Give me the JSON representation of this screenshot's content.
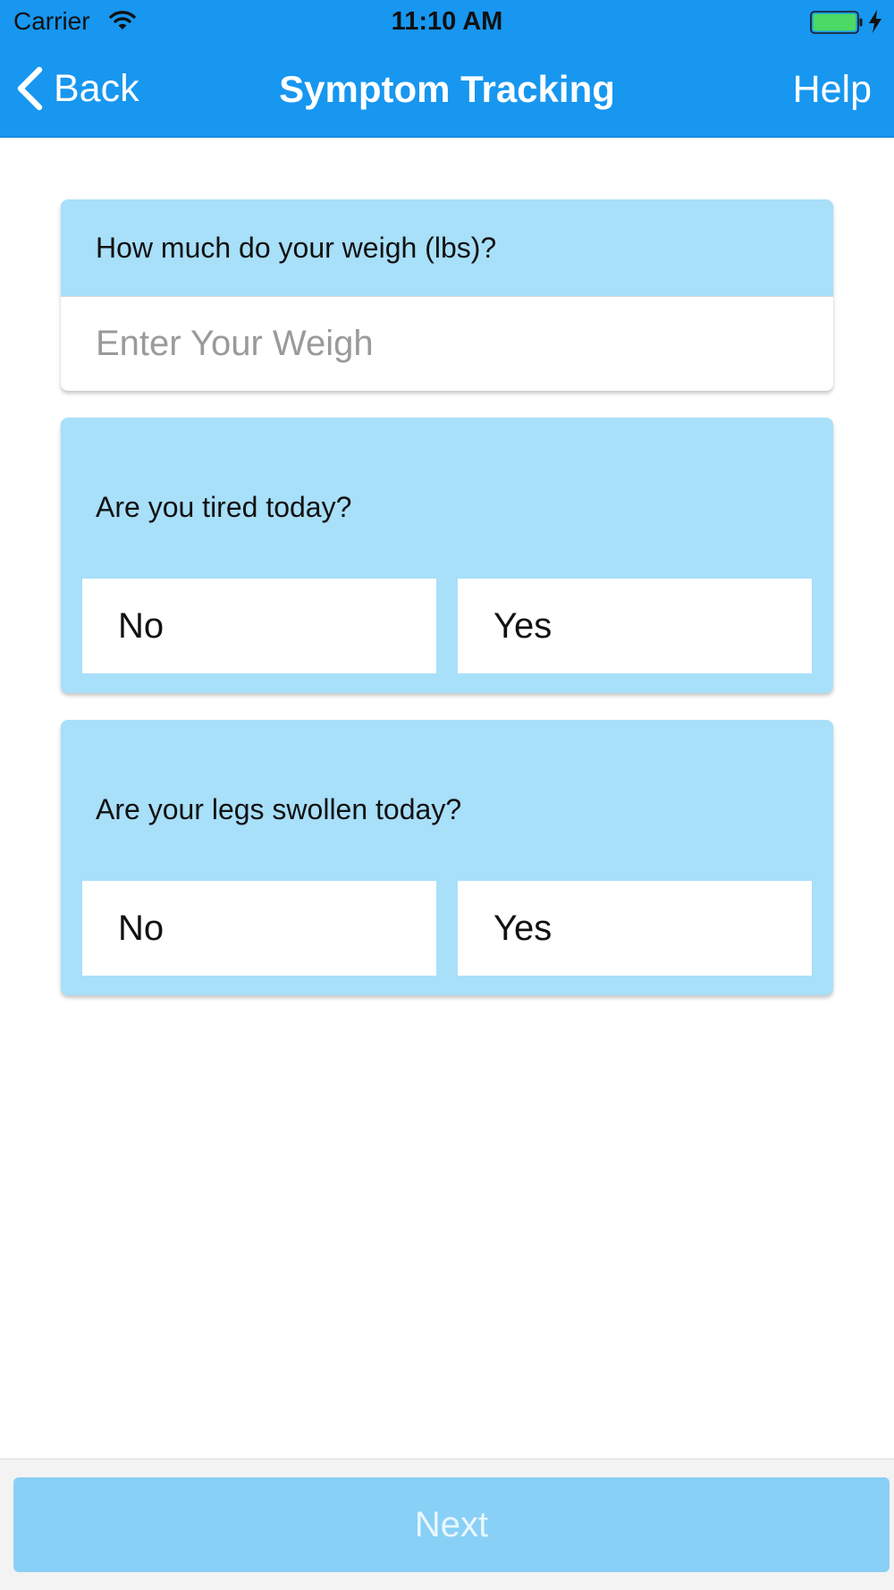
{
  "status_bar": {
    "carrier": "Carrier",
    "time": "11:10 AM",
    "wifi_icon": "wifi-icon",
    "battery_icon": "battery-icon",
    "charging_icon": "charging-bolt-icon"
  },
  "nav": {
    "back_label": "Back",
    "back_icon": "chevron-left-icon",
    "title": "Symptom Tracking",
    "help_label": "Help"
  },
  "weight": {
    "question": "How much do your weigh (lbs)?",
    "value": "",
    "placeholder": "Enter Your Weigh"
  },
  "tired": {
    "question": "Are you tired today?",
    "no_label": "No",
    "yes_label": "Yes"
  },
  "legs": {
    "question": "Are your legs swollen today?",
    "no_label": "No",
    "yes_label": "Yes"
  },
  "footer": {
    "next_label": "Next",
    "next_enabled": false
  },
  "colors": {
    "nav_bar": "#1797f0",
    "card": "#a8dff9",
    "next_button": "#89d0f6",
    "battery_fill": "#4cd964"
  }
}
